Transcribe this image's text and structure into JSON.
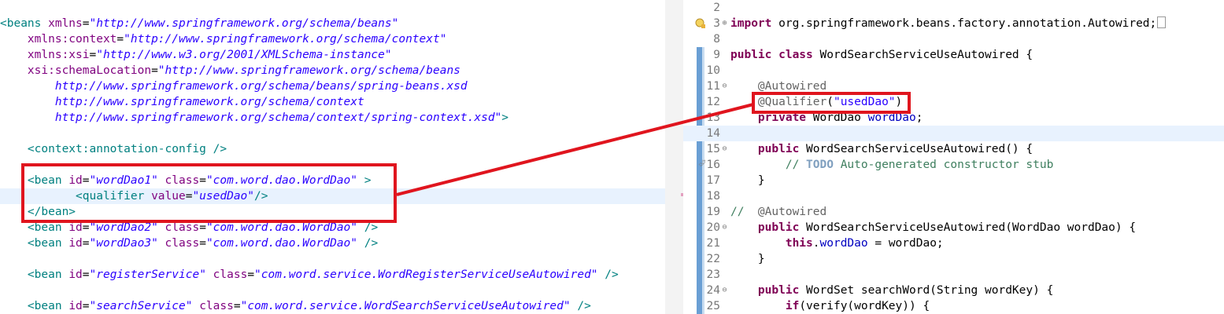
{
  "xml_editor": {
    "line1": {
      "open": "<beans ",
      "attr": "xmlns",
      "eq": "=",
      "val": "\"http://www.springframework.org/schema/beans\""
    },
    "line2": {
      "attr": "xmlns:context",
      "eq": "=",
      "val": "\"http://www.springframework.org/schema/context\""
    },
    "line3": {
      "attr": "xmlns:xsi",
      "eq": "=",
      "val": "\"http://www.w3.org/2001/XMLSchema-instance\""
    },
    "line4": {
      "attr": "xsi:schemaLocation",
      "eq": "=",
      "val": "\"http://www.springframework.org/schema/beans"
    },
    "line5": {
      "val": "http://www.springframework.org/schema/beans/spring-beans.xsd"
    },
    "line6": {
      "val": "http://www.springframework.org/schema/context"
    },
    "line7": {
      "val": "http://www.springframework.org/schema/context/spring-context.xsd\"",
      "close": ">"
    },
    "line9": {
      "tag": "<context:annotation-config />"
    },
    "line11": {
      "open": "<bean ",
      "a1": "id",
      "eq1": "=",
      "v1": "\"wordDao1\"",
      "a2": " class",
      "eq2": "=",
      "v2": "\"com.word.dao.WordDao\"",
      "close": " >"
    },
    "line12": {
      "open": "<qualifier ",
      "a1": "value",
      "eq1": "=",
      "v1": "\"usedDao\"",
      "close": "/>"
    },
    "line13": {
      "tag": "</bean>"
    },
    "line14": {
      "open": "<bean ",
      "a1": "id",
      "eq1": "=",
      "v1": "\"wordDao2\"",
      "a2": " class",
      "eq2": "=",
      "v2": "\"com.word.dao.WordDao\"",
      "close": " />"
    },
    "line15": {
      "open": "<bean ",
      "a1": "id",
      "eq1": "=",
      "v1": "\"wordDao3\"",
      "a2": " class",
      "eq2": "=",
      "v2": "\"com.word.dao.WordDao\"",
      "close": " />"
    },
    "line17": {
      "open": "<bean ",
      "a1": "id",
      "eq1": "=",
      "v1": "\"registerService\"",
      "a2": " class",
      "eq2": "=",
      "v2": "\"com.word.service.WordRegisterServiceUseAutowired\"",
      "close": " />"
    },
    "line19": {
      "open": "<bean ",
      "a1": "id",
      "eq1": "=",
      "v1": "\"searchService\"",
      "a2": " class",
      "eq2": "=",
      "v2": "\"com.word.service.WordSearchServiceUseAutowired\"",
      "close": " />"
    }
  },
  "java_editor": {
    "line_numbers": [
      "2",
      "3",
      "8",
      "9",
      "10",
      "11",
      "12",
      "13",
      "14",
      "15",
      "16",
      "17",
      "18",
      "19",
      "20",
      "21",
      "22",
      "23",
      "24",
      "25"
    ],
    "l3": {
      "kw": "import",
      "rest": " org.springframework.beans.factory.annotation.Autowired;"
    },
    "l9": {
      "kw": "public class",
      "rest": " WordSearchServiceUseAutowired {"
    },
    "l11": {
      "ann": "@Autowired"
    },
    "l12": {
      "ann": "@Qualifier",
      "p1": "(",
      "str": "\"usedDao\"",
      "p2": ")"
    },
    "l13": {
      "kw": "private",
      "rest": " WordDao ",
      "fld": "wordDao",
      "end": ";"
    },
    "l15": {
      "kw": "public",
      "rest": " WordSearchServiceUseAutowired() {"
    },
    "l16": {
      "cmt1": "// ",
      "todo": "TODO",
      "cmt2": " Auto-generated constructor stub"
    },
    "l17": {
      "rest": "}"
    },
    "l19": {
      "cmt": "//",
      "ann": "  @Autowired"
    },
    "l20": {
      "kw": "public",
      "rest": " WordSearchServiceUseAutowired(WordDao ",
      "param": "wordDao",
      "end": ") {"
    },
    "l21": {
      "kw": "this",
      "p": ".",
      "fld": "wordDao",
      "rest": " = ",
      "param": "wordDao",
      "end": ";"
    },
    "l22": {
      "rest": "}"
    },
    "l24": {
      "kw": "public",
      "rest": " WordSet searchWord(String ",
      "param": "wordKey",
      "end": ") {"
    },
    "l25": {
      "kw": "if",
      "rest": "(verify(",
      "param": "wordKey",
      "end": ")) {"
    }
  },
  "colors": {
    "highlight_box": "#e0151e",
    "current_line": "#e8f2fe",
    "change_bar": "#6a9fd4"
  }
}
